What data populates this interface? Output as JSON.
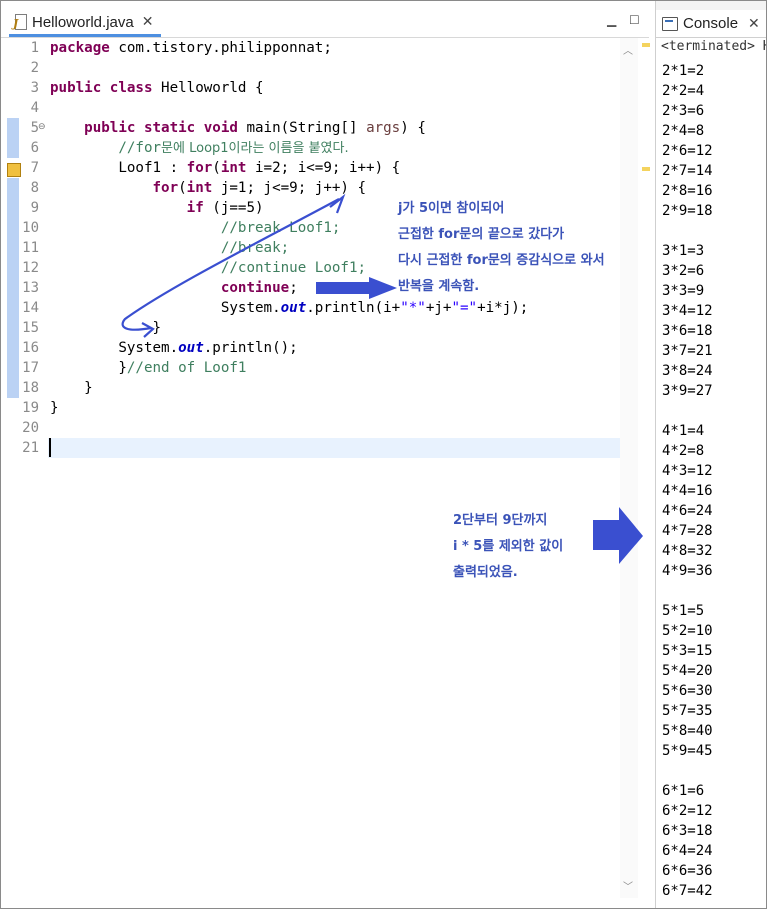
{
  "editor": {
    "tab_title": "Helloworld.java",
    "line_numbers": [
      "1",
      "2",
      "3",
      "4",
      "5",
      "6",
      "7",
      "8",
      "9",
      "10",
      "11",
      "12",
      "13",
      "14",
      "15",
      "16",
      "17",
      "18",
      "19",
      "20",
      "21"
    ],
    "code": {
      "l1": [
        "package",
        " com.tistory.philipponnat;"
      ],
      "l3": [
        "public",
        " ",
        "class",
        " Helloworld {"
      ],
      "l5": [
        "    ",
        "public",
        " ",
        "static",
        " ",
        "void",
        " main(String[] ",
        "args",
        ") {"
      ],
      "l6": [
        "        //for",
        "문에 Loop1이라는 이름을 붙였다."
      ],
      "l7": [
        "        Loof1 : ",
        "for",
        "(",
        "int",
        " i=2; i<=9; i++) {"
      ],
      "l8": [
        "            ",
        "for",
        "(",
        "int",
        " j=1; j<=9; j++) {"
      ],
      "l9": [
        "                ",
        "if",
        " (j==5)"
      ],
      "l10": "                    //break Loof1;",
      "l11": "                    //break;",
      "l12": "                    //continue Loof1;",
      "l13": [
        "                    ",
        "continue",
        ";"
      ],
      "l14": [
        "                    System.",
        "out",
        ".println(i+",
        "\"*\"",
        "+j+",
        "\"=\"",
        "+i*j);"
      ],
      "l15": "            }",
      "l16": [
        "        System.",
        "out",
        ".println();"
      ],
      "l17": [
        "        }",
        "//end of Loof1"
      ],
      "l18": "    }",
      "l19": "}"
    }
  },
  "annotation": {
    "right": [
      "j가 5이면 참이되어",
      "근접한 for문의 끝으로 갔다가",
      "다시 근접한 for문의 증감식으로 와서",
      "반복을 계속함."
    ],
    "bottom": [
      "2단부터 9단까지",
      "i * 5를 제외한 값이",
      "출력되었음."
    ]
  },
  "console": {
    "tab_title": "Console",
    "status": "<terminated> H",
    "lines": [
      "2*1=2",
      "2*2=4",
      "2*3=6",
      "2*4=8",
      "2*6=12",
      "2*7=14",
      "2*8=16",
      "2*9=18",
      "",
      "3*1=3",
      "3*2=6",
      "3*3=9",
      "3*4=12",
      "3*6=18",
      "3*7=21",
      "3*8=24",
      "3*9=27",
      "",
      "4*1=4",
      "4*2=8",
      "4*3=12",
      "4*4=16",
      "4*6=24",
      "4*7=28",
      "4*8=32",
      "4*9=36",
      "",
      "5*1=5",
      "5*2=10",
      "5*3=15",
      "5*4=20",
      "5*6=30",
      "5*7=35",
      "5*8=40",
      "5*9=45",
      "",
      "6*1=6",
      "6*2=12",
      "6*3=18",
      "6*4=24",
      "6*6=36",
      "6*7=42"
    ]
  },
  "colors": {
    "keyword": "#7f0055",
    "comment": "#3f7f5f",
    "field": "#0000c0",
    "string": "#2a00ff",
    "annotation": "#3b53b8",
    "arrow": "#3a4fd0"
  }
}
